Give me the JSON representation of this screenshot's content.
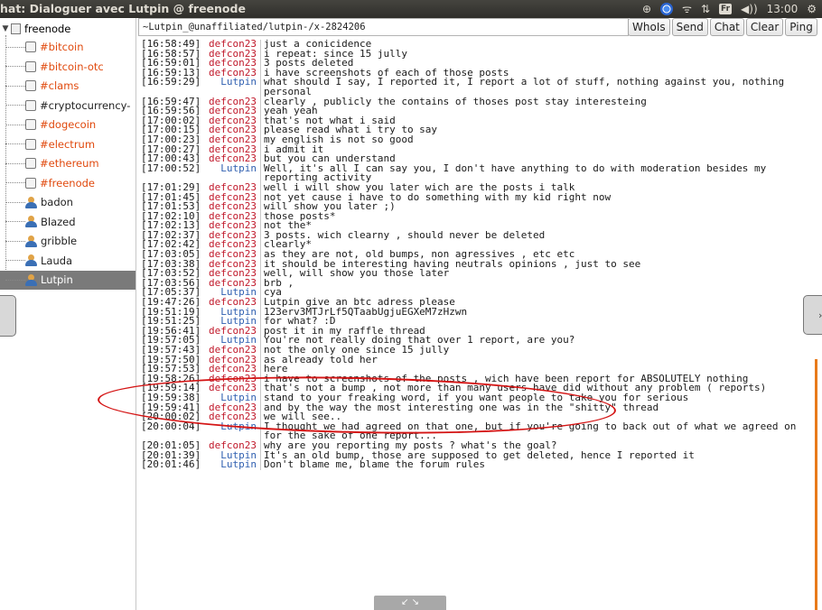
{
  "window": {
    "title": "hat: Dialoguer avec Lutpin @ freenode"
  },
  "tray": {
    "lang": "Fr",
    "time": "13:00"
  },
  "sidebar": {
    "network": "freenode",
    "channels": [
      "#bitcoin",
      "#bitcoin-otc",
      "#clams",
      "#cryptocurrency-",
      "#dogecoin",
      "#electrum",
      "#ethereum",
      "#freenode"
    ],
    "users": [
      "badon",
      "Blazed",
      "gribble",
      "Lauda",
      "Lutpin"
    ],
    "selected_user": "Lutpin"
  },
  "topic": "~Lutpin_@unaffiliated/lutpin-/x-2824206",
  "buttons": {
    "whois": "WhoIs",
    "send": "Send",
    "chat": "Chat",
    "clear": "Clear",
    "ping": "Ping"
  },
  "colors": {
    "defcon23": "#c0182a",
    "Lutpin": "#2f5fb0",
    "channel": "#e0490d"
  },
  "messages": [
    {
      "t": "[16:58:49]",
      "n": "defcon23",
      "m": "just a conicidence"
    },
    {
      "t": "[16:58:57]",
      "n": "defcon23",
      "m": "i repeat: since 15 jully"
    },
    {
      "t": "[16:59:01]",
      "n": "defcon23",
      "m": "3 posts deleted"
    },
    {
      "t": "[16:59:13]",
      "n": "defcon23",
      "m": "i have screenshots of each of those posts"
    },
    {
      "t": "[16:59:29]",
      "n": "Lutpin",
      "m": "what should I say, I reported it, I report a lot of stuff, nothing against you, nothing personal"
    },
    {
      "t": "[16:59:47]",
      "n": "defcon23",
      "m": "clearly , publicly the contains of thoses post stay interesteing"
    },
    {
      "t": "[16:59:56]",
      "n": "defcon23",
      "m": "yeah yeah"
    },
    {
      "t": "[17:00:02]",
      "n": "defcon23",
      "m": "that's not what i said"
    },
    {
      "t": "[17:00:15]",
      "n": "defcon23",
      "m": "please read what i try to say"
    },
    {
      "t": "[17:00:23]",
      "n": "defcon23",
      "m": "my english is not so good"
    },
    {
      "t": "[17:00:27]",
      "n": "defcon23",
      "m": "i admit it"
    },
    {
      "t": "[17:00:43]",
      "n": "defcon23",
      "m": "but you can understand"
    },
    {
      "t": "[17:00:52]",
      "n": "Lutpin",
      "m": "Well, it's all I can say you, I don't have anything to do with moderation besides my reporting activity"
    },
    {
      "t": "[17:01:29]",
      "n": "defcon23",
      "m": "well i will show you later wich are the posts i talk"
    },
    {
      "t": "[17:01:45]",
      "n": "defcon23",
      "m": "not yet cause i have to do something with my kid right now"
    },
    {
      "t": "[17:01:53]",
      "n": "defcon23",
      "m": "will show you later ;)"
    },
    {
      "t": "[17:02:10]",
      "n": "defcon23",
      "m": "those posts*"
    },
    {
      "t": "[17:02:13]",
      "n": "defcon23",
      "m": "not the*"
    },
    {
      "t": "[17:02:37]",
      "n": "defcon23",
      "m": "3 posts. wich clearny , should never be deleted"
    },
    {
      "t": "[17:02:42]",
      "n": "defcon23",
      "m": "clearly*"
    },
    {
      "t": "[17:03:05]",
      "n": "defcon23",
      "m": "as they are not, old bumps, non agressives , etc etc"
    },
    {
      "t": "[17:03:38]",
      "n": "defcon23",
      "m": "it should be interesting having neutrals opinions , just to see"
    },
    {
      "t": "[17:03:52]",
      "n": "defcon23",
      "m": "well, will show you those later"
    },
    {
      "t": "[17:03:56]",
      "n": "defcon23",
      "m": "brb ,"
    },
    {
      "t": "[17:05:37]",
      "n": "Lutpin",
      "m": "cya"
    },
    {
      "t": "[19:47:26]",
      "n": "defcon23",
      "m": "Lutpin give an btc adress please"
    },
    {
      "t": "[19:51:19]",
      "n": "Lutpin",
      "m": "123erv3MTJrLf5QTaabUgjuEGXeM7zHzwn"
    },
    {
      "t": "[19:51:25]",
      "n": "Lutpin",
      "m": "for what? :D"
    },
    {
      "t": "[19:56:41]",
      "n": "defcon23",
      "m": "post it in my raffle thread"
    },
    {
      "t": "[19:57:05]",
      "n": "Lutpin",
      "m": "You're not really doing that over 1 report, are you?"
    },
    {
      "t": "[19:57:43]",
      "n": "defcon23",
      "m": "not the only one since 15 jully"
    },
    {
      "t": "[19:57:50]",
      "n": "defcon23",
      "m": "as already told her"
    },
    {
      "t": "[19:57:53]",
      "n": "defcon23",
      "m": "here"
    },
    {
      "t": "[19:58:26]",
      "n": "defcon23",
      "m": "i have to screenshots of the posts , wich have been report for ABSOLUTELY nothing"
    },
    {
      "t": "[19:59:14]",
      "n": "defcon23",
      "m": "that's not a bump , not more than many users have did without any problem ( reports)"
    },
    {
      "t": "[19:59:38]",
      "n": "Lutpin",
      "m": "stand to your freaking word, if you want people to take you for serious"
    },
    {
      "t": "[19:59:41]",
      "n": "defcon23",
      "m": "and by the way the most interesting one was in the \"shitty\" thread"
    },
    {
      "t": "[20:00:02]",
      "n": "defcon23",
      "m": "we will see.."
    },
    {
      "t": "[20:00:04]",
      "n": "Lutpin",
      "m": "I thought we had agreed on that one, but if you're going to back out of what we agreed on for the sake of one report..."
    },
    {
      "t": "[20:01:05]",
      "n": "defcon23",
      "m": "why are you reporting my posts ?  what's the goal?"
    },
    {
      "t": "[20:01:39]",
      "n": "Lutpin",
      "m": "It's an old bump, those are supposed to get deleted, hence I reported it"
    },
    {
      "t": "[20:01:46]",
      "n": "Lutpin",
      "m": "Don't blame me, blame the forum rules"
    }
  ]
}
